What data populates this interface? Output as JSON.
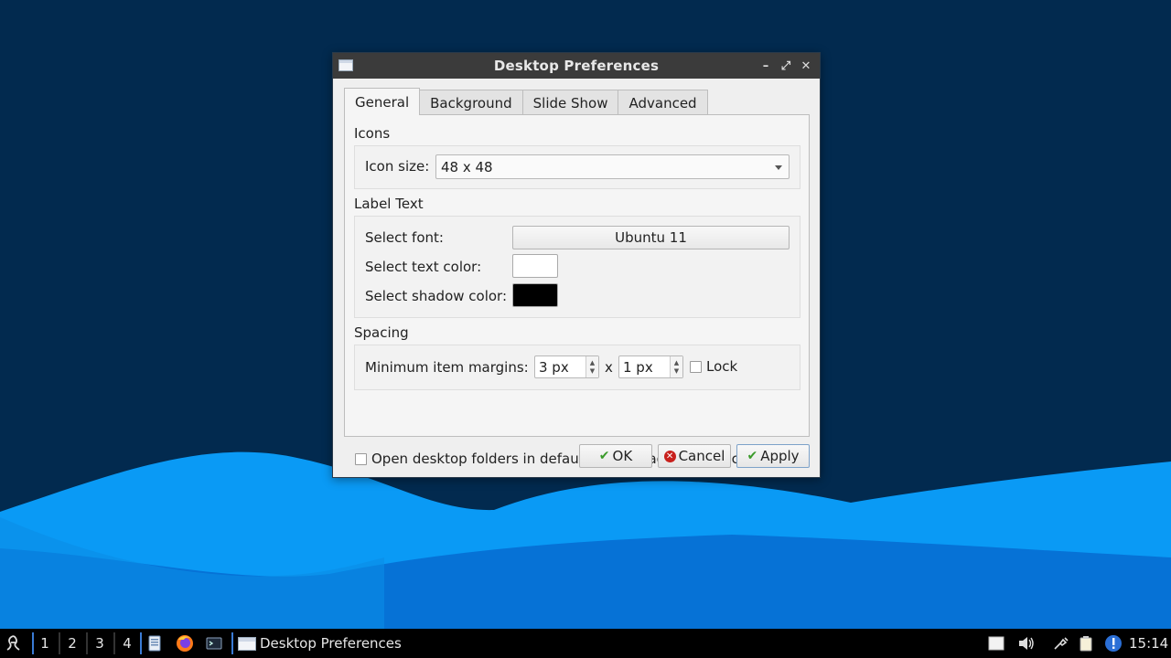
{
  "window": {
    "title": "Desktop Preferences",
    "controls": {
      "minimize": "–",
      "maximize": "⤢",
      "close": "✕"
    },
    "tabs": [
      "General",
      "Background",
      "Slide Show",
      "Advanced"
    ],
    "active_tab": "General",
    "sections": {
      "icons": {
        "label": "Icons",
        "icon_size_label": "Icon size:",
        "icon_size_value": "48 x 48"
      },
      "label_text": {
        "label": "Label Text",
        "font_label": "Select font:",
        "font_value": "Ubuntu 11",
        "text_color_label": "Select text color:",
        "text_color": "#ffffff",
        "shadow_color_label": "Select shadow color:",
        "shadow_color": "#000000"
      },
      "spacing": {
        "label": "Spacing",
        "margins_label": "Minimum item margins:",
        "margin_x": "3 px",
        "separator": "x",
        "margin_y": "1 px",
        "lock_label": "Lock",
        "lock_checked": false
      }
    },
    "open_folders_label": "Open desktop folders in default file manager by left clicking",
    "open_folders_checked": false,
    "buttons": {
      "ok": "OK",
      "cancel": "Cancel",
      "apply": "Apply"
    }
  },
  "taskbar": {
    "workspaces": [
      "1",
      "2",
      "3",
      "4"
    ],
    "task_title": "Desktop Preferences",
    "clock": "15:14"
  },
  "colors": {
    "desktop_bg": "#022a4f",
    "wave_light": "#0a9af5",
    "wave_dark": "#0672d6",
    "taskbar": "#000000",
    "accent": "#3a7bd5"
  }
}
